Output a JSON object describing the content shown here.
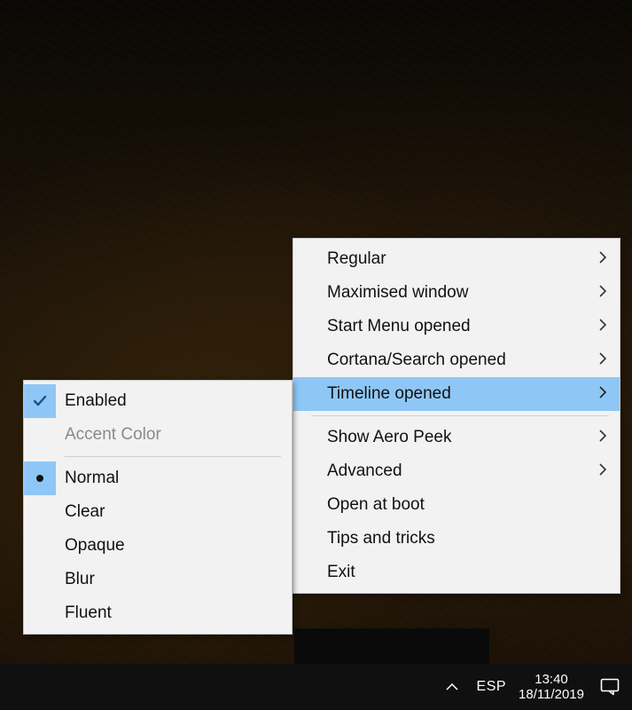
{
  "taskbar": {
    "language": "ESP",
    "time": "13:40",
    "date": "18/11/2019"
  },
  "mainmenu": {
    "items": [
      {
        "label": "Regular",
        "submenu": true
      },
      {
        "label": "Maximised window",
        "submenu": true
      },
      {
        "label": "Start Menu opened",
        "submenu": true
      },
      {
        "label": "Cortana/Search opened",
        "submenu": true
      },
      {
        "label": "Timeline opened",
        "submenu": true,
        "highlight": true
      }
    ],
    "items2": [
      {
        "label": "Show Aero Peek",
        "submenu": true
      },
      {
        "label": "Advanced",
        "submenu": true
      },
      {
        "label": "Open at boot"
      },
      {
        "label": "Tips and tricks"
      },
      {
        "label": "Exit"
      }
    ]
  },
  "submenu": {
    "items": [
      {
        "label": "Enabled",
        "checked": true
      },
      {
        "label": "Accent Color",
        "disabled": true
      }
    ],
    "items2": [
      {
        "label": "Normal",
        "radio": true
      },
      {
        "label": "Clear"
      },
      {
        "label": "Opaque"
      },
      {
        "label": "Blur"
      },
      {
        "label": "Fluent"
      }
    ]
  }
}
